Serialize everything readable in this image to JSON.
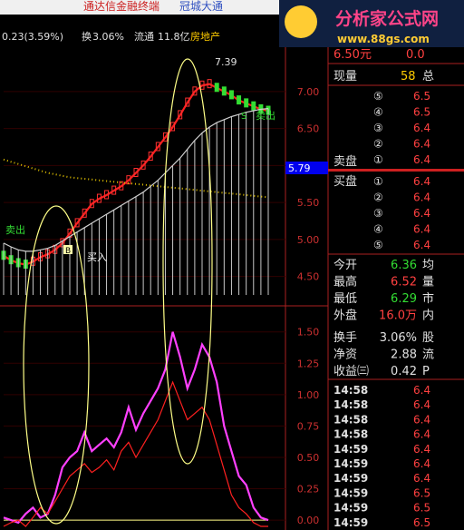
{
  "window": {
    "title": "通达信金融终端",
    "subtitle": "冠城大通"
  },
  "watermark": {
    "title": "分析家公式网",
    "url": "www.88gs.com"
  },
  "info_bar": {
    "change": "0.23(3.59%)",
    "turnover_label": "换",
    "turnover": "3.06%",
    "float_label": "流通",
    "float_value": "11.8亿",
    "sector": "房地产"
  },
  "price_tag": "5.79",
  "annotations": {
    "high": "7.39",
    "sell_top": "卖出",
    "sell_left": "卖出",
    "buy": "买入",
    "buy_badge": "B",
    "sell_badge": "S"
  },
  "side_panel": {
    "price_top": "6.50元",
    "price_top_change": "0.0",
    "volume_label": "现量",
    "volume_value": "58",
    "volume_suffix": "总",
    "sell_label": "卖盘",
    "buy_label": "买盘",
    "sell_rows": [
      {
        "level": "⑤",
        "price": "6.5"
      },
      {
        "level": "④",
        "price": "6.5"
      },
      {
        "level": "③",
        "price": "6.4"
      },
      {
        "level": "②",
        "price": "6.4"
      },
      {
        "level": "①",
        "price": "6.4"
      }
    ],
    "buy_rows": [
      {
        "level": "①",
        "price": "6.4"
      },
      {
        "level": "②",
        "price": "6.4"
      },
      {
        "level": "③",
        "price": "6.4"
      },
      {
        "level": "④",
        "price": "6.4"
      },
      {
        "level": "⑤",
        "price": "6.4"
      }
    ],
    "stats": [
      {
        "label": "今开",
        "value": "6.36",
        "suffix": "均",
        "color": "#33dd33"
      },
      {
        "label": "最高",
        "value": "6.52",
        "suffix": "量",
        "color": "#ff4040"
      },
      {
        "label": "最低",
        "value": "6.29",
        "suffix": "市",
        "color": "#33dd33"
      },
      {
        "label": "外盘",
        "value": "16.0万",
        "suffix": "内",
        "color": "#ff4040"
      },
      {
        "label": "换手",
        "value": "3.06%",
        "suffix": "股",
        "color": "#e0e0e0"
      },
      {
        "label": "净资",
        "value": "2.88",
        "suffix": "流",
        "color": "#e0e0e0"
      },
      {
        "label": "收益㈢",
        "value": "0.42",
        "suffix": "P",
        "color": "#e0e0e0"
      }
    ],
    "ticks": [
      {
        "time": "14:58",
        "price": "6.4"
      },
      {
        "time": "14:58",
        "price": "6.4"
      },
      {
        "time": "14:58",
        "price": "6.4"
      },
      {
        "time": "14:58",
        "price": "6.4"
      },
      {
        "time": "14:59",
        "price": "6.4"
      },
      {
        "time": "14:59",
        "price": "6.4"
      },
      {
        "time": "14:59",
        "price": "6.4"
      },
      {
        "time": "14:59",
        "price": "6.5"
      },
      {
        "time": "14:59",
        "price": "6.5"
      },
      {
        "time": "14:59",
        "price": "6.5"
      }
    ]
  },
  "chart_data": [
    {
      "type": "line",
      "panel": "price",
      "y_ticks": [
        4.5,
        5.0,
        5.5,
        6.0,
        6.5,
        7.0
      ],
      "ylim": [
        4.25,
        7.55
      ],
      "series": [
        {
          "color": "#ff2020",
          "values": [
            4.78,
            4.72,
            4.68,
            4.66,
            4.7,
            4.76,
            4.8,
            4.86,
            4.95,
            5.08,
            5.22,
            5.35,
            5.48,
            5.55,
            5.6,
            5.66,
            5.72,
            5.8,
            5.9,
            6.0,
            6.12,
            6.25,
            6.38,
            6.52,
            6.68,
            6.85,
            7.0,
            7.08,
            7.1,
            7.05,
            7.0,
            6.95,
            6.88,
            6.84,
            6.8,
            6.76,
            6.74
          ]
        },
        {
          "color": "#d0d0d0",
          "values": [
            4.95,
            4.9,
            4.86,
            4.84,
            4.84,
            4.86,
            4.88,
            4.92,
            4.98,
            5.04,
            5.1,
            5.16,
            5.22,
            5.28,
            5.34,
            5.4,
            5.46,
            5.52,
            5.58,
            5.64,
            5.72,
            5.8,
            5.9,
            6.0,
            6.1,
            6.22,
            6.34,
            6.44,
            6.52,
            6.58,
            6.62,
            6.66,
            6.69,
            6.72,
            6.74,
            6.76,
            6.77
          ]
        },
        {
          "color": "#e0c000",
          "style": "dotted",
          "values": [
            6.08,
            6.05,
            6.02,
            5.99,
            5.96,
            5.93,
            5.9,
            5.88,
            5.86,
            5.84,
            5.83,
            5.82,
            5.81,
            5.8,
            5.79,
            5.78,
            5.77,
            5.76,
            5.75,
            5.74,
            5.73,
            5.72,
            5.71,
            5.7,
            5.69,
            5.68,
            5.67,
            5.66,
            5.65,
            5.64,
            5.63,
            5.62,
            5.61,
            5.6,
            5.59,
            5.58,
            5.57
          ]
        }
      ]
    },
    {
      "type": "line",
      "panel": "indicator",
      "y_ticks": [
        0.0,
        0.25,
        0.5,
        0.75,
        1.0,
        1.25,
        1.5
      ],
      "ylim": [
        -0.05,
        1.65
      ],
      "series": [
        {
          "color": "#ff40ff",
          "values": [
            0.02,
            0.0,
            -0.02,
            0.05,
            0.1,
            0.02,
            0.05,
            0.2,
            0.42,
            0.5,
            0.55,
            0.7,
            0.55,
            0.6,
            0.65,
            0.58,
            0.7,
            0.9,
            0.72,
            0.85,
            0.95,
            1.05,
            1.2,
            1.5,
            1.3,
            1.05,
            1.2,
            1.4,
            1.3,
            1.1,
            0.75,
            0.55,
            0.35,
            0.28,
            0.1,
            0.02,
            0.0
          ]
        },
        {
          "color": "#ff2020",
          "values": [
            -0.05,
            -0.02,
            0.0,
            -0.05,
            0.02,
            0.1,
            0.05,
            0.15,
            0.25,
            0.35,
            0.4,
            0.45,
            0.38,
            0.42,
            0.48,
            0.4,
            0.55,
            0.62,
            0.5,
            0.6,
            0.7,
            0.8,
            0.95,
            1.1,
            0.95,
            0.8,
            0.85,
            0.9,
            0.8,
            0.6,
            0.4,
            0.2,
            0.1,
            0.05,
            -0.02,
            -0.05,
            -0.05
          ]
        }
      ]
    }
  ]
}
